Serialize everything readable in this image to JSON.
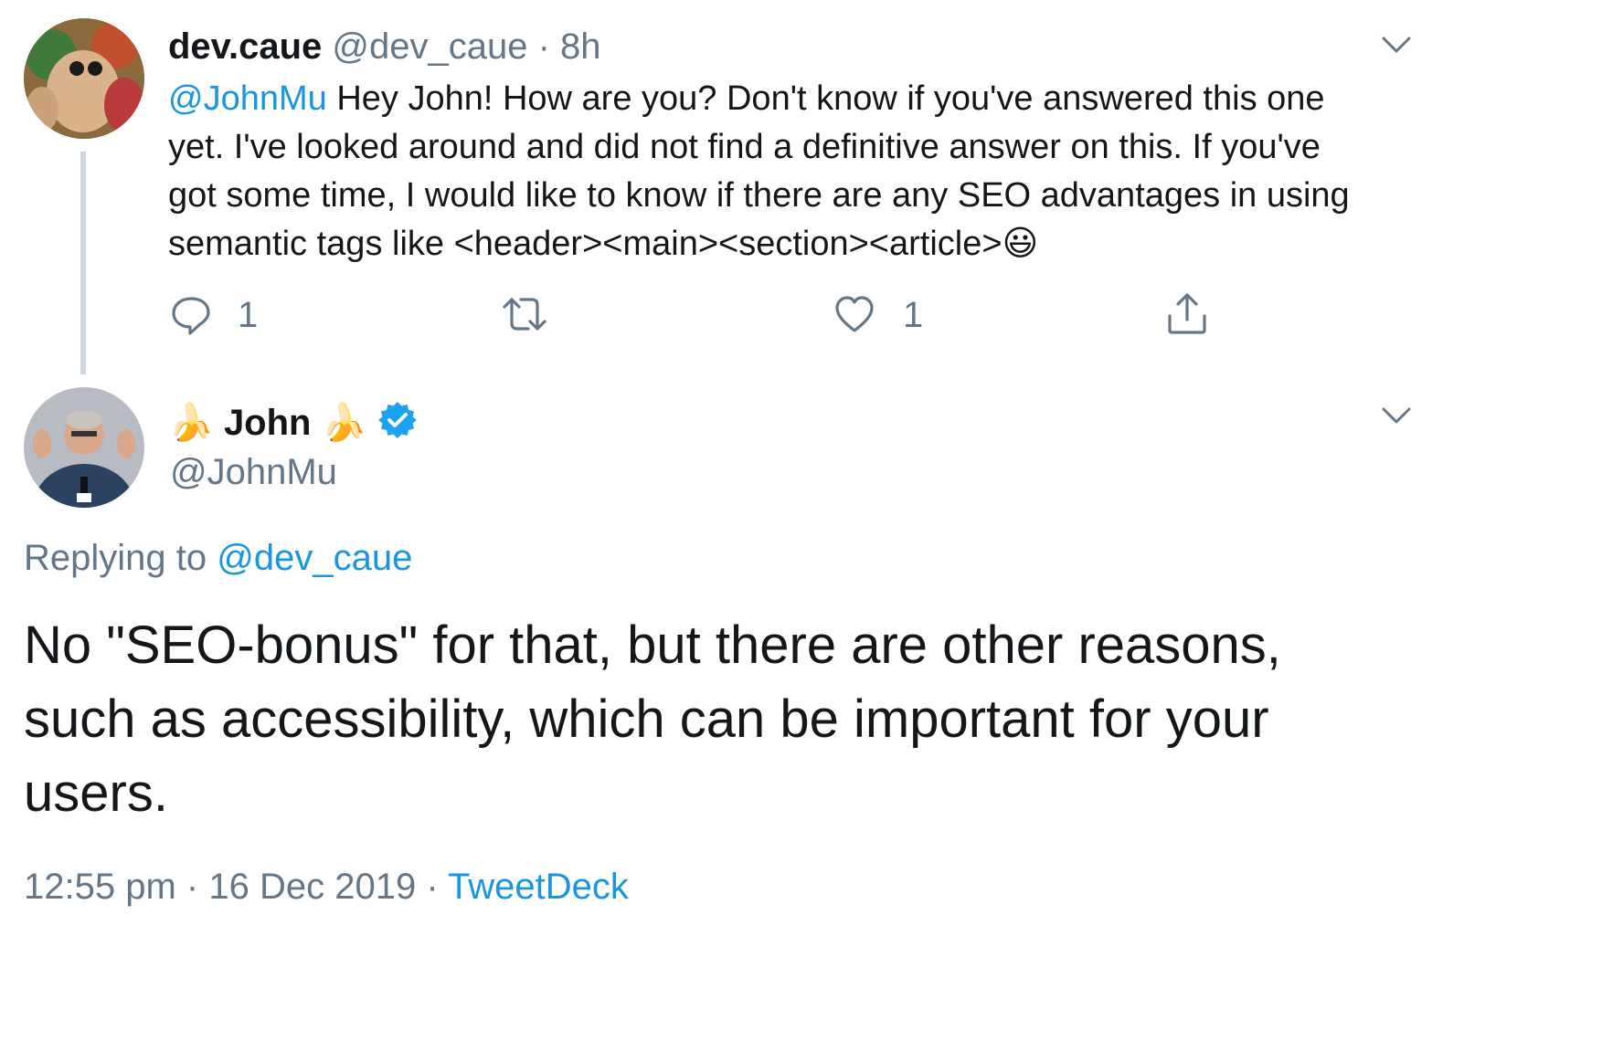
{
  "parent_tweet": {
    "display_name": "dev.caue",
    "handle": "@dev_caue",
    "separator": "·",
    "time_ago": "8h",
    "mention": "@JohnMu",
    "text_line1": " Hey John! How are you? Don't know if you've answered this one",
    "text_line2": "yet. I've looked around and did not find a definitive answer on this. If you've",
    "text_line3": "got some time, I would like to know if there are any SEO advantages in using",
    "text_line4": "semantic tags like <header><main><section><article>",
    "emoji": "😃",
    "reply_count": "1",
    "like_count": "1"
  },
  "reply_tweet": {
    "name_emoji_left": "🍌",
    "display_name": "John",
    "name_emoji_right": "🍌",
    "handle": "@JohnMu",
    "replying_label": "Replying to",
    "replying_handle": "@dev_caue",
    "text_line1": "No \"SEO-bonus\" for that, but there are other reasons,",
    "text_line2": "such as accessibility, which can be important for your",
    "text_line3": "users.",
    "time": "12:55 pm",
    "sep1": "·",
    "date": "16 Dec 2019",
    "sep2": "·",
    "client": "TweetDeck"
  },
  "icons": {
    "reply": "reply-icon",
    "retweet": "retweet-icon",
    "like": "heart-icon",
    "share": "share-icon",
    "verified": "verified-badge-icon",
    "menu": "chevron-down-icon"
  },
  "colors": {
    "link": "#1b95e0",
    "muted": "#657786",
    "text": "#14171a",
    "verified": "#1da1f2",
    "thread_line": "#ccd6dd"
  }
}
